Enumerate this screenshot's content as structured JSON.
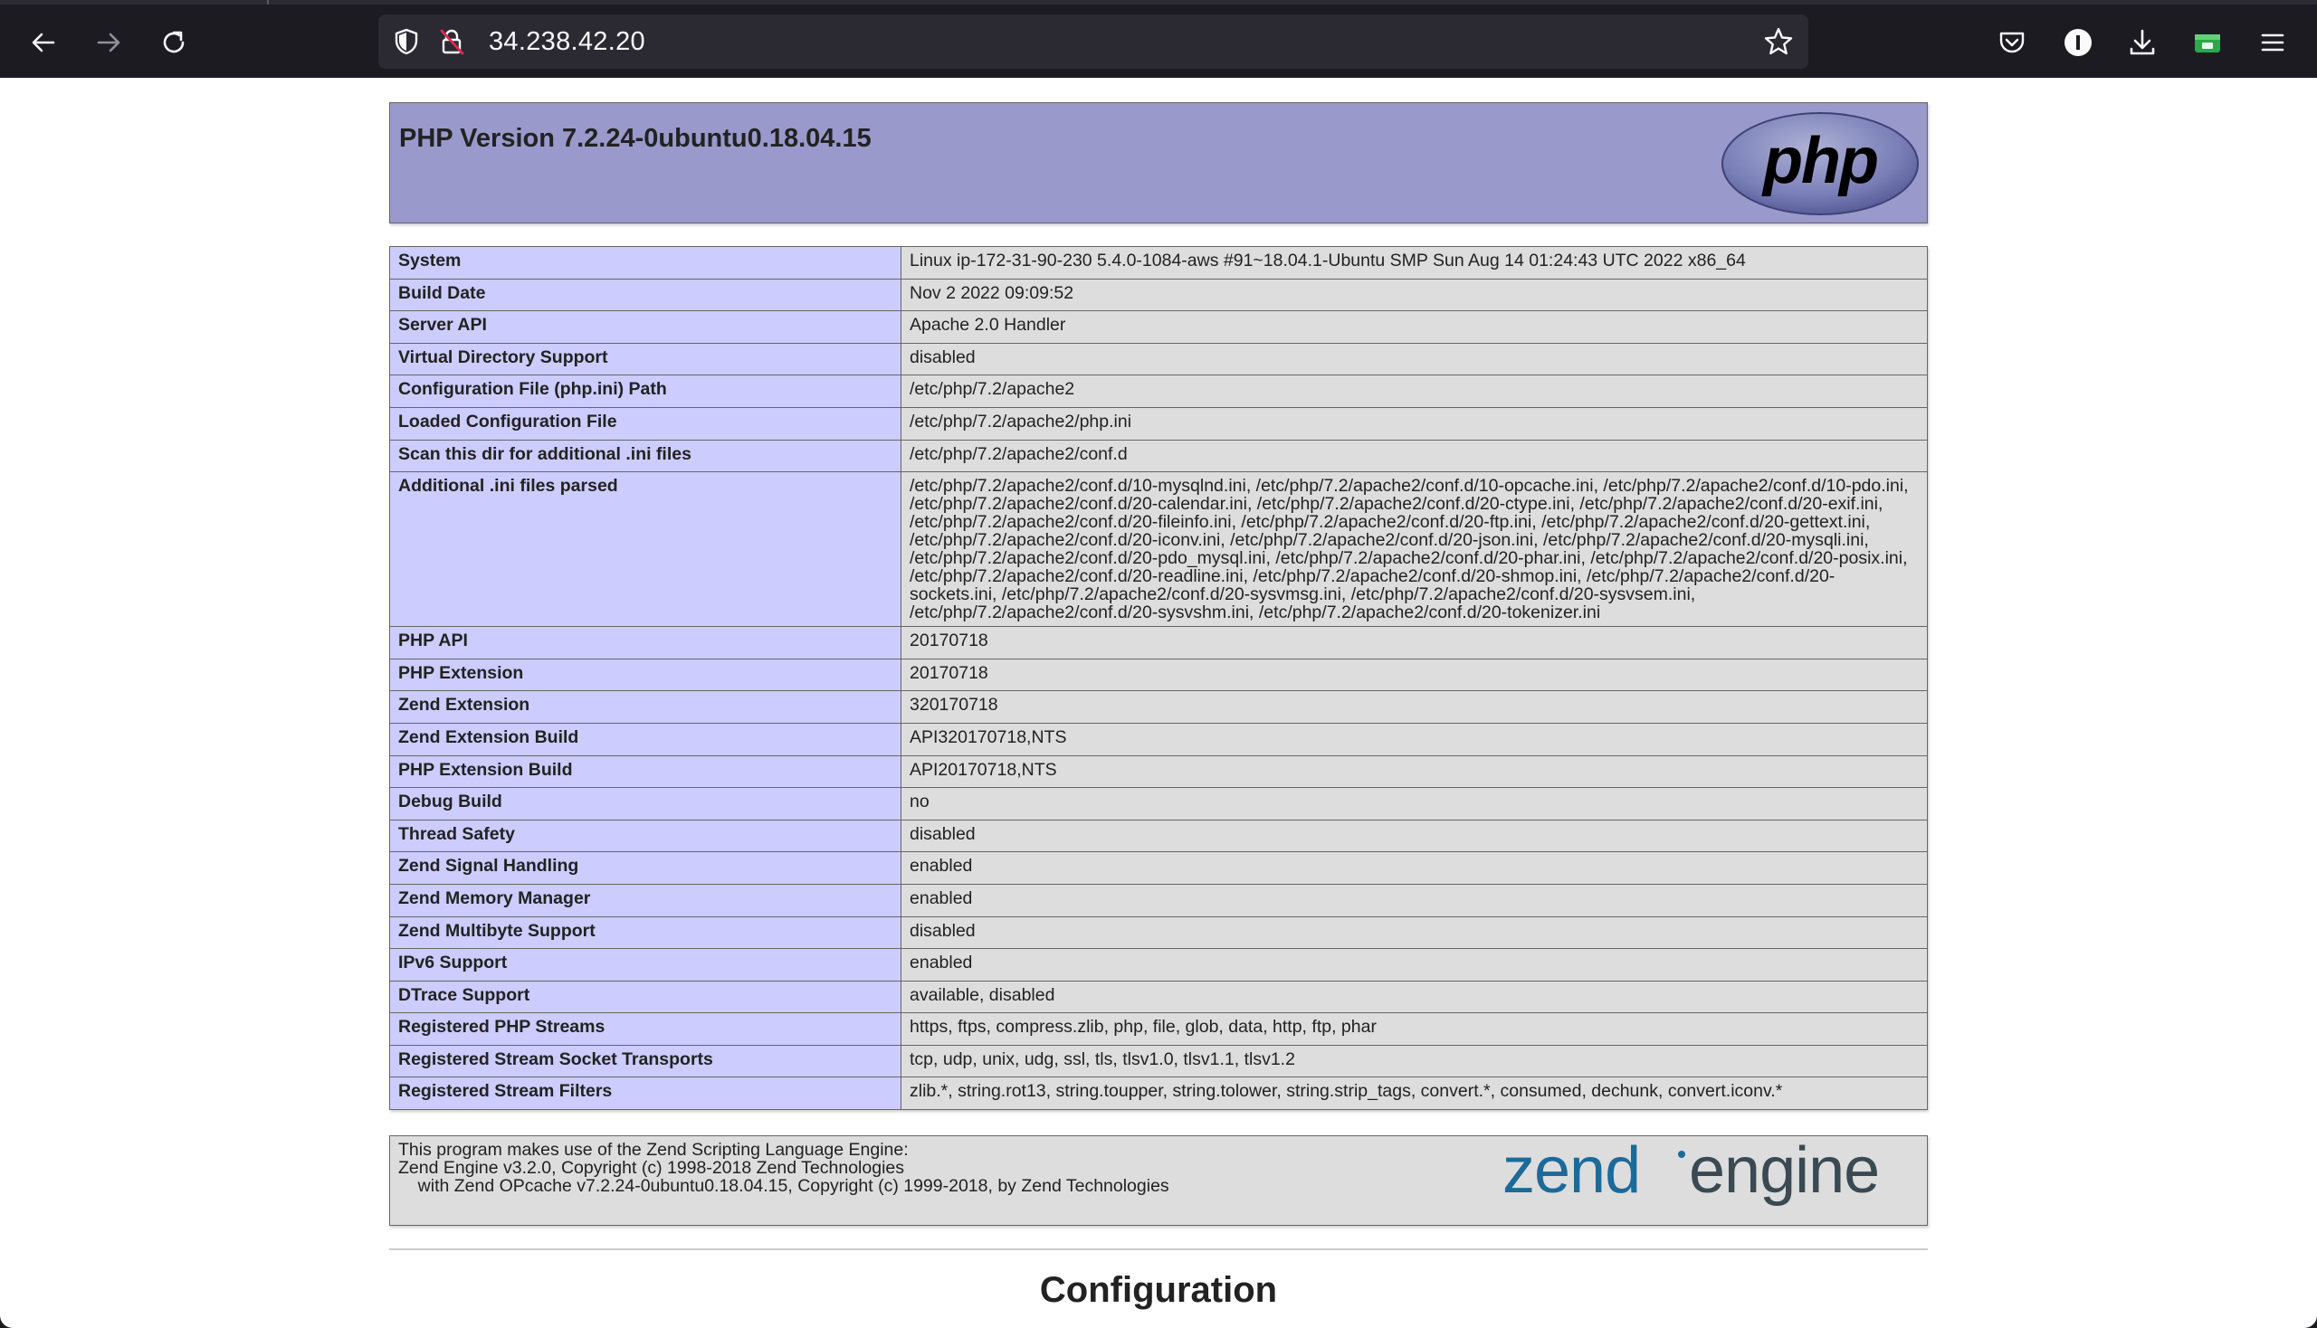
{
  "browser": {
    "url": "34.238.42.20",
    "icons": [
      "back-arrow-icon",
      "forward-arrow-icon",
      "reload-icon",
      "shield-icon",
      "insecure-lock-icon",
      "bookmark-star-icon",
      "pocket-icon",
      "extension-icon",
      "download-icon",
      "wallet-extension-icon",
      "menu-icon"
    ]
  },
  "page": {
    "title": "PHP Version 7.2.24-0ubuntu0.18.04.15",
    "logo": "php",
    "rows": [
      {
        "key": "System",
        "value": "Linux ip-172-31-90-230 5.4.0-1084-aws #91~18.04.1-Ubuntu SMP Sun Aug 14 01:24:43 UTC 2022 x86_64"
      },
      {
        "key": "Build Date",
        "value": "Nov 2 2022 09:09:52"
      },
      {
        "key": "Server API",
        "value": "Apache 2.0 Handler"
      },
      {
        "key": "Virtual Directory Support",
        "value": "disabled"
      },
      {
        "key": "Configuration File (php.ini) Path",
        "value": "/etc/php/7.2/apache2"
      },
      {
        "key": "Loaded Configuration File",
        "value": "/etc/php/7.2/apache2/php.ini"
      },
      {
        "key": "Scan this dir for additional .ini files",
        "value": "/etc/php/7.2/apache2/conf.d"
      },
      {
        "key": "Additional .ini files parsed",
        "value": "/etc/php/7.2/apache2/conf.d/10-mysqlnd.ini, /etc/php/7.2/apache2/conf.d/10-opcache.ini, /etc/php/7.2/apache2/conf.d/10-pdo.ini, /etc/php/7.2/apache2/conf.d/20-calendar.ini, /etc/php/7.2/apache2/conf.d/20-ctype.ini, /etc/php/7.2/apache2/conf.d/20-exif.ini, /etc/php/7.2/apache2/conf.d/20-fileinfo.ini, /etc/php/7.2/apache2/conf.d/20-ftp.ini, /etc/php/7.2/apache2/conf.d/20-gettext.ini, /etc/php/7.2/apache2/conf.d/20-iconv.ini, /etc/php/7.2/apache2/conf.d/20-json.ini, /etc/php/7.2/apache2/conf.d/20-mysqli.ini, /etc/php/7.2/apache2/conf.d/20-pdo_mysql.ini, /etc/php/7.2/apache2/conf.d/20-phar.ini, /etc/php/7.2/apache2/conf.d/20-posix.ini, /etc/php/7.2/apache2/conf.d/20-readline.ini, /etc/php/7.2/apache2/conf.d/20-shmop.ini, /etc/php/7.2/apache2/conf.d/20-sockets.ini, /etc/php/7.2/apache2/conf.d/20-sysvmsg.ini, /etc/php/7.2/apache2/conf.d/20-sysvsem.ini, /etc/php/7.2/apache2/conf.d/20-sysvshm.ini, /etc/php/7.2/apache2/conf.d/20-tokenizer.ini"
      },
      {
        "key": "PHP API",
        "value": "20170718"
      },
      {
        "key": "PHP Extension",
        "value": "20170718"
      },
      {
        "key": "Zend Extension",
        "value": "320170718"
      },
      {
        "key": "Zend Extension Build",
        "value": "API320170718,NTS"
      },
      {
        "key": "PHP Extension Build",
        "value": "API20170718,NTS"
      },
      {
        "key": "Debug Build",
        "value": "no"
      },
      {
        "key": "Thread Safety",
        "value": "disabled"
      },
      {
        "key": "Zend Signal Handling",
        "value": "enabled"
      },
      {
        "key": "Zend Memory Manager",
        "value": "enabled"
      },
      {
        "key": "Zend Multibyte Support",
        "value": "disabled"
      },
      {
        "key": "IPv6 Support",
        "value": "enabled"
      },
      {
        "key": "DTrace Support",
        "value": "available, disabled"
      },
      {
        "key": "Registered PHP Streams",
        "value": "https, ftps, compress.zlib, php, file, glob, data, http, ftp, phar"
      },
      {
        "key": "Registered Stream Socket Transports",
        "value": "tcp, udp, unix, udg, ssl, tls, tlsv1.0, tlsv1.1, tlsv1.2"
      },
      {
        "key": "Registered Stream Filters",
        "value": "zlib.*, string.rot13, string.toupper, string.tolower, string.strip_tags, convert.*, consumed, dechunk, convert.iconv.*"
      }
    ],
    "zend": {
      "line1": "This program makes use of the Zend Scripting Language Engine:",
      "line2": "Zend Engine v3.2.0, Copyright (c) 1998-2018 Zend Technologies",
      "line3": "    with Zend OPcache v7.2.24-0ubuntu0.18.04.15, Copyright (c) 1999-2018, by Zend Technologies",
      "logo_word1": "zend",
      "logo_word2": "engine"
    },
    "section_heading": "Configuration"
  }
}
